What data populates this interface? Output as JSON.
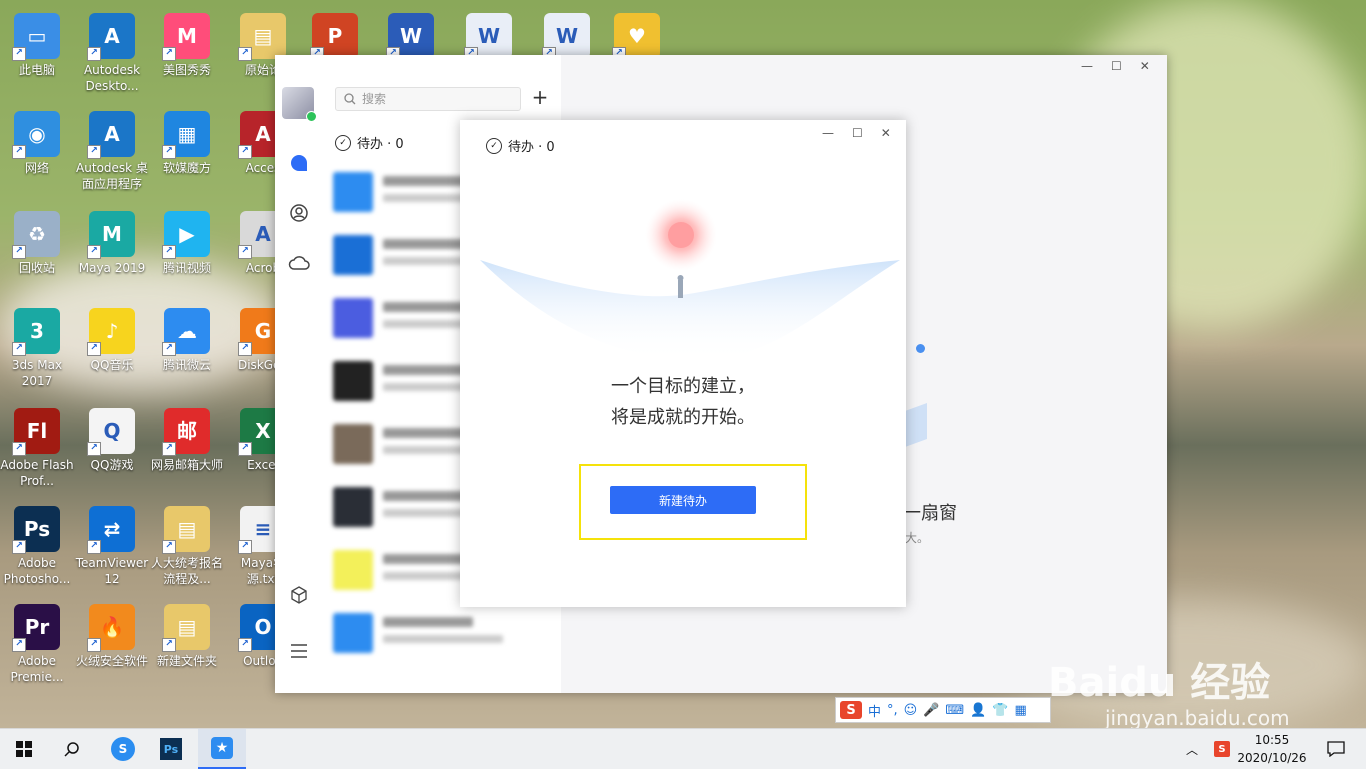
{
  "desktop": {
    "icons": [
      {
        "label": "此电脑",
        "color": "#3a8ee6",
        "glyph": "▭"
      },
      {
        "label": "Autodesk Deskto...",
        "color": "#1b76c8",
        "glyph": "A"
      },
      {
        "label": "美图秀秀",
        "color": "#ff4d7a",
        "glyph": "M"
      },
      {
        "label": "原始论",
        "color": "#e8c86a",
        "glyph": "▤"
      },
      {
        "label": "",
        "color": "#d04423",
        "glyph": "P"
      },
      {
        "label": "",
        "color": "#2b5cb8",
        "glyph": "W"
      },
      {
        "label": "",
        "color": "#e9eef7",
        "glyph": "W"
      },
      {
        "label": "",
        "color": "#e9eef7",
        "glyph": "W"
      },
      {
        "label": "",
        "color": "#f0c030",
        "glyph": "♥"
      },
      {
        "label": "网络",
        "color": "#2f8fe0",
        "glyph": "◉"
      },
      {
        "label": "Autodesk 桌面应用程序",
        "color": "#1b76c8",
        "glyph": "A"
      },
      {
        "label": "软媒魔方",
        "color": "#1f86e0",
        "glyph": "▦"
      },
      {
        "label": "Acces",
        "color": "#b7242a",
        "glyph": "A"
      },
      {
        "label": "回收站",
        "color": "#9ab0c8",
        "glyph": "♻"
      },
      {
        "label": "Maya 2019",
        "color": "#1aa9a3",
        "glyph": "M"
      },
      {
        "label": "腾讯视频",
        "color": "#1fb4f0",
        "glyph": "▶"
      },
      {
        "label": "Acrob",
        "color": "#d9d9d9",
        "glyph": "A"
      },
      {
        "label": "3ds Max 2017",
        "color": "#1aa9a3",
        "glyph": "3"
      },
      {
        "label": "QQ音乐",
        "color": "#f7d41e",
        "glyph": "♪"
      },
      {
        "label": "腾讯微云",
        "color": "#2d8cf0",
        "glyph": "☁"
      },
      {
        "label": "DiskGen",
        "color": "#f07a1a",
        "glyph": "G"
      },
      {
        "label": "Adobe Flash Prof...",
        "color": "#a11b12",
        "glyph": "Fl"
      },
      {
        "label": "QQ游戏",
        "color": "#f4f4f4",
        "glyph": "Q"
      },
      {
        "label": "网易邮箱大师",
        "color": "#e02b2b",
        "glyph": "邮"
      },
      {
        "label": "Excel",
        "color": "#1d7a45",
        "glyph": "X"
      },
      {
        "label": "Adobe Photosho...",
        "color": "#0c2f52",
        "glyph": "Ps"
      },
      {
        "label": "TeamViewer 12",
        "color": "#0e6fd4",
        "glyph": "⇄"
      },
      {
        "label": "人大统考报名流程及...",
        "color": "#e8c86a",
        "glyph": "▤"
      },
      {
        "label": "Maya学源.txt",
        "color": "#f2f2f2",
        "glyph": "≡"
      },
      {
        "label": "Adobe Premie...",
        "color": "#2a0f47",
        "glyph": "Pr"
      },
      {
        "label": "火绒安全软件",
        "color": "#f28a1d",
        "glyph": "🔥"
      },
      {
        "label": "新建文件夹",
        "color": "#e8c86a",
        "glyph": "▤"
      },
      {
        "label": "Outloo",
        "color": "#0a64c2",
        "glyph": "O"
      }
    ]
  },
  "app": {
    "search_placeholder": "搜索",
    "todo_header": "待办 · 0",
    "minimize": "—",
    "maximize": "☐",
    "close": "✕"
  },
  "todo_popup": {
    "title": "待办 · 0",
    "slogan_line1": "一个目标的建立，",
    "slogan_line2": "将是成就的开始。",
    "new_button": "新建待办"
  },
  "right_pane": {
    "title_fragment": "一扇窗",
    "sub_fragment": "大。"
  },
  "ime": {
    "logo": "S",
    "mode": "中"
  },
  "taskbar": {
    "time": "10:55",
    "date": "2020/10/26"
  },
  "watermark": {
    "brand": "Baidu 经验",
    "url": "jingyan.baidu.com"
  },
  "colors": {
    "accent": "#2d6cf6",
    "highlight": "#f5e20a"
  }
}
